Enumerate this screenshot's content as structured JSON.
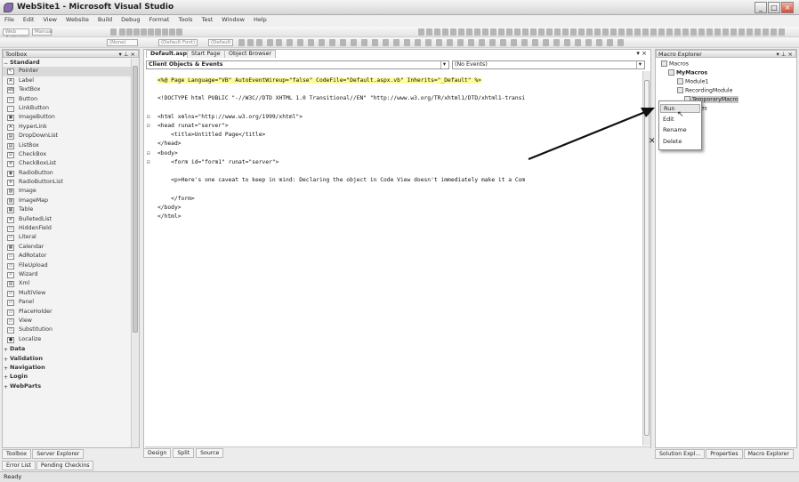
{
  "window": {
    "title": "WebSite1 - Microsoft Visual Studio",
    "min": "_",
    "max": "□",
    "close": "×"
  },
  "menu": [
    "File",
    "Edit",
    "View",
    "Website",
    "Build",
    "Debug",
    "Format",
    "Tools",
    "Test",
    "Window",
    "Help"
  ],
  "toolbar1": {
    "config": "Web Authorize",
    "target": "Manual"
  },
  "toolbar2": {
    "block": "(None)",
    "font": "(Default Font)",
    "size": "(Default"
  },
  "toolbox": {
    "title": "Toolbox",
    "pin": "▾ ⊥ ×",
    "section": "Standard",
    "items": [
      {
        "label": "Pointer",
        "icon": "↖",
        "sel": true
      },
      {
        "label": "Label",
        "icon": "A"
      },
      {
        "label": "TextBox",
        "icon": "ab"
      },
      {
        "label": "Button",
        "icon": "▭"
      },
      {
        "label": "LinkButton",
        "icon": "◌"
      },
      {
        "label": "ImageButton",
        "icon": "▣"
      },
      {
        "label": "HyperLink",
        "icon": "A"
      },
      {
        "label": "DropDownList",
        "icon": "▤"
      },
      {
        "label": "ListBox",
        "icon": "▤"
      },
      {
        "label": "CheckBox",
        "icon": "☑"
      },
      {
        "label": "CheckBoxList",
        "icon": "≡"
      },
      {
        "label": "RadioButton",
        "icon": "◉"
      },
      {
        "label": "RadioButtonList",
        "icon": "≡"
      },
      {
        "label": "Image",
        "icon": "▨"
      },
      {
        "label": "ImageMap",
        "icon": "▨"
      },
      {
        "label": "Table",
        "icon": "▦"
      },
      {
        "label": "BulletedList",
        "icon": "≡"
      },
      {
        "label": "HiddenField",
        "icon": "▭"
      },
      {
        "label": "Literal",
        "icon": "▭"
      },
      {
        "label": "Calendar",
        "icon": "▦"
      },
      {
        "label": "AdRotator",
        "icon": "▭"
      },
      {
        "label": "FileUpload",
        "icon": "▭"
      },
      {
        "label": "Wizard",
        "icon": "✧"
      },
      {
        "label": "Xml",
        "icon": "▤"
      },
      {
        "label": "MultiView",
        "icon": "▭"
      },
      {
        "label": "Panel",
        "icon": "▭"
      },
      {
        "label": "PlaceHolder",
        "icon": "▭"
      },
      {
        "label": "View",
        "icon": "▭"
      },
      {
        "label": "Substitution",
        "icon": "▭"
      },
      {
        "label": "Localize",
        "icon": "●"
      }
    ],
    "categories": [
      {
        "label": "Data",
        "pm": "+"
      },
      {
        "label": "Validation",
        "pm": "+"
      },
      {
        "label": "Navigation",
        "pm": "+"
      },
      {
        "label": "Login",
        "pm": "+"
      },
      {
        "label": "WebParts",
        "pm": "+"
      }
    ]
  },
  "leftTabs": [
    "Toolbox",
    "Server Explorer"
  ],
  "bottomLeftTabs": [
    "Error List",
    "Pending Checkins"
  ],
  "editor": {
    "tabs": [
      "Default.aspx*",
      "Start Page",
      "Object Browser"
    ],
    "close": "▾ ×",
    "leftCombo": "Client Objects & Events",
    "rightCombo": "(No Events)",
    "lines": [
      "<%@ Page Language=\"VB\" AutoEventWireup=\"false\" CodeFile=\"Default.aspx.vb\" Inherits=\"_Default\" %>",
      "",
      "<!DOCTYPE html PUBLIC \"-//W3C//DTD XHTML 1.0 Transitional//EN\" \"http://www.w3.org/TR/xhtml1/DTD/xhtml1-transi",
      "",
      "<html xmlns=\"http://www.w3.org/1999/xhtml\">",
      "<head runat=\"server\">",
      "    <title>Untitled Page</title>",
      "</head>",
      "<body>",
      "    <form id=\"form1\" runat=\"server\">",
      "",
      "    <p>Here's one caveat to keep in mind: Declaring the object in Code View doesn't immediately make it a Com",
      "",
      "    </form>",
      "</body>",
      "</html>"
    ],
    "views": [
      "Design",
      "Split",
      "Source"
    ]
  },
  "macroExplorer": {
    "title": "Macro Explorer",
    "pin": "▾ ⊥ ×",
    "tree": [
      {
        "label": "Macros",
        "bold": false
      },
      {
        "label": "MyMacros",
        "bold": true
      },
      {
        "label": "Module1",
        "bold": false
      },
      {
        "label": "RecordingModule",
        "bold": false
      },
      {
        "label": "TemporaryMacro",
        "bold": false
      },
      {
        "label": "les",
        "bold": false
      }
    ],
    "bottomTabs": [
      "Solution Expl...",
      "Properties",
      "Macro Explorer"
    ]
  },
  "contextMenu": [
    "Run",
    "Edit",
    "Rename",
    "Delete"
  ],
  "status": "Ready"
}
